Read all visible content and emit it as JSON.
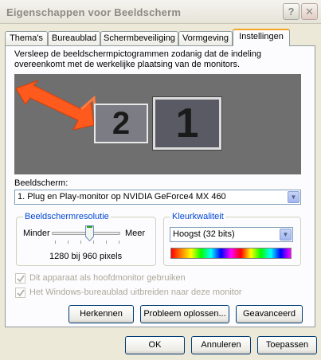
{
  "window": {
    "title": "Eigenschappen voor Beeldscherm",
    "help_label": "?",
    "close_label": "✕"
  },
  "tabs": [
    {
      "label": "Thema's"
    },
    {
      "label": "Bureaublad"
    },
    {
      "label": "Schermbeveiliging"
    },
    {
      "label": "Vormgeving"
    },
    {
      "label": "Instellingen",
      "active": true
    }
  ],
  "settings": {
    "description": "Versleep de beeldschermpictogrammen zodanig dat de indeling overeenkomt met de werkelijke plaatsing van de monitors.",
    "monitors": [
      {
        "label": "2"
      },
      {
        "label": "1"
      }
    ],
    "display_label": "Beeldscherm:",
    "display_value": "1. Plug en Play-monitor op NVIDIA GeForce4 MX 460",
    "resolution": {
      "legend": "Beeldschermresolutie",
      "min_label": "Minder",
      "max_label": "Meer",
      "value_text": "1280 bij 960 pixels",
      "slider_level": 0.55
    },
    "color_quality": {
      "legend": "Kleurkwaliteit",
      "value": "Hoogst (32 bits)"
    },
    "checkbox_primary": {
      "label": "Dit apparaat als hoofdmonitor gebruiken",
      "checked": true,
      "disabled": true
    },
    "checkbox_extend": {
      "label": "Het Windows-bureaublad uitbreiden naar deze monitor",
      "checked": true,
      "disabled": true
    },
    "buttons": {
      "identify": "Herkennen",
      "troubleshoot": "Probleem oplossen...",
      "advanced": "Geavanceerd"
    }
  },
  "footer": {
    "ok": "OK",
    "cancel": "Annuleren",
    "apply": "Toepassen"
  },
  "colors": {
    "accent_tab": "#f5a623",
    "preview_bg": "#6f6f6f",
    "arrow": "#ff5a1e",
    "legend_text": "#0046d5"
  },
  "icons": {
    "dropdown": "chevron-down-icon",
    "drag_hint": "arrow-icon",
    "check": "check-icon"
  }
}
